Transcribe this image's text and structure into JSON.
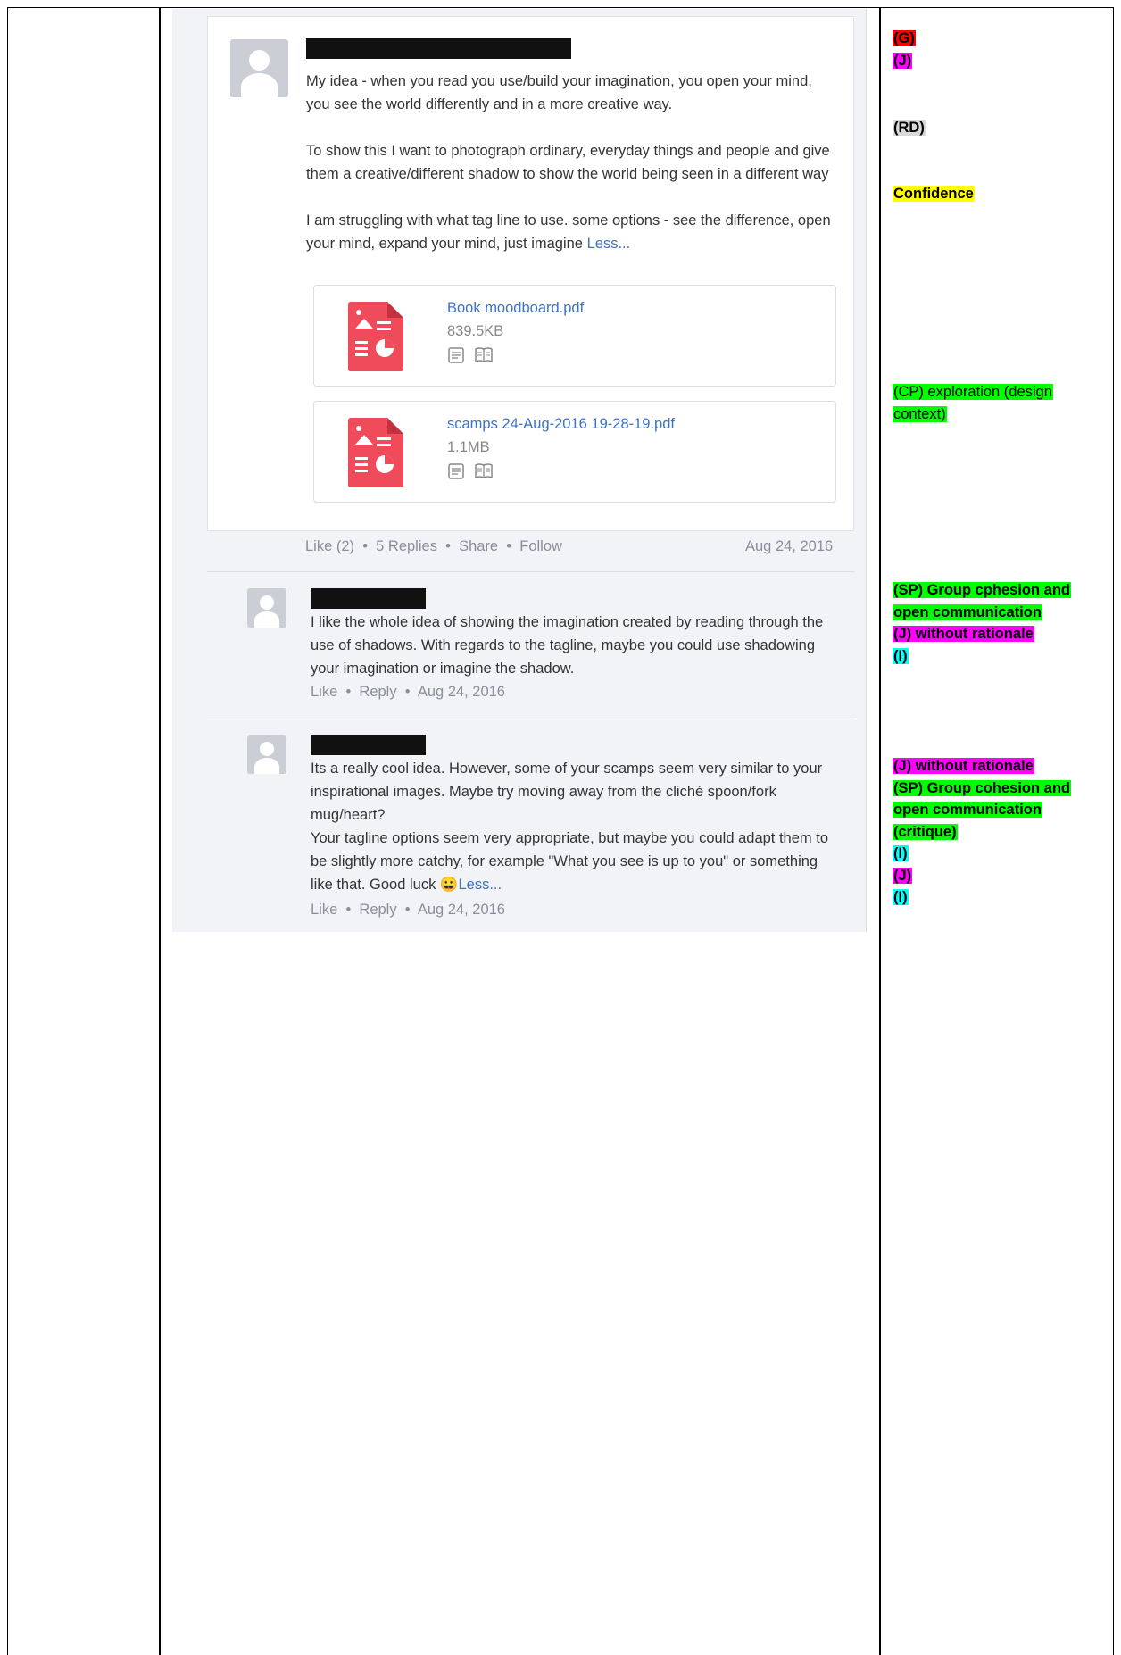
{
  "post": {
    "body": "My idea - when you read you use/build your imagination, you open your mind, you see the world differently and in a more creative way.\n\nTo show this I want to photograph ordinary, everyday things and people and give them a creative/different shadow to show the world being seen in a different way\n\nI am struggling with what tag line to use. some options - see the difference, open your mind, expand your mind, just imagine",
    "less_link": "Less...",
    "attachments": [
      {
        "name": "Book moodboard.pdf",
        "size": "839.5KB"
      },
      {
        "name": "scamps 24-Aug-2016 19-28-19.pdf",
        "size": "1.1MB"
      }
    ],
    "footer": {
      "like": "Like (2)",
      "replies": "5 Replies",
      "share": "Share",
      "follow": "Follow",
      "date": "Aug 24, 2016",
      "dot": "•"
    }
  },
  "replies": [
    {
      "body": "I like the whole idea of showing the imagination created by reading through the use of shadows. With regards to the tagline, maybe you could use shadowing your imagination or imagine the shadow.",
      "like": "Like",
      "reply": "Reply",
      "date": "Aug 24, 2016"
    },
    {
      "body": "Its a really cool idea. However, some of your scamps seem very similar to your inspirational images. Maybe try moving away from the cliché spoon/fork mug/heart?\nYour tagline options seem very appropriate, but maybe you could adapt them to be slightly more catchy, for example \"What you see is up to you\" or something like that. Good luck",
      "emoji": "😀",
      "less_link": "Less...",
      "like": "Like",
      "reply": "Reply",
      "date": "Aug 24, 2016"
    }
  ],
  "annotations": {
    "a1": "(G)",
    "a2": "(J)",
    "a3": "(RD)",
    "a4": "Confidence",
    "a5": "(CP) exploration (design",
    "a6": "context)",
    "a7": "(SP) Group cphesion and",
    "a8": "open communication",
    "a9": "(J) without rationale",
    "a10": "(I)",
    "a11": "(J) without rationale",
    "a12": "(SP) Group cohesion and",
    "a13": "open communication",
    "a14": "(critique)",
    "a15": "(I)",
    "a16": "(J)",
    "a17": "(I)"
  },
  "colors": {
    "link": "#3d72c6",
    "pdf_red": "#ef4b5a"
  }
}
